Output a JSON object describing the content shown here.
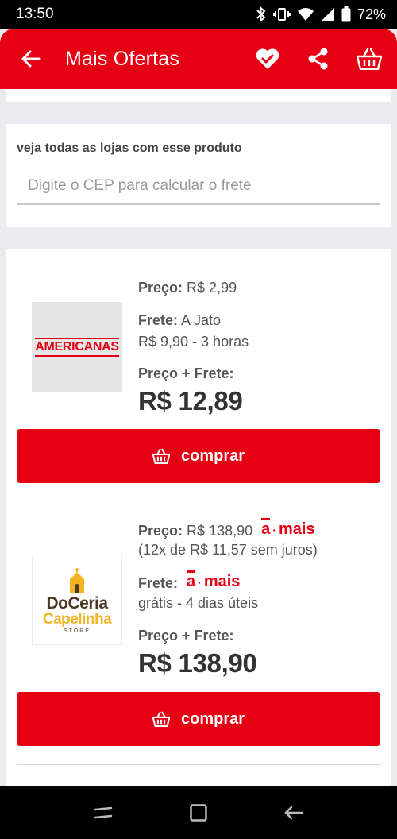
{
  "status_bar": {
    "time": "13:50",
    "battery": "72%"
  },
  "app_bar": {
    "title": "Mais Ofertas",
    "icons": [
      "back-arrow-icon",
      "heart-icon",
      "share-icon",
      "basket-icon"
    ]
  },
  "cep": {
    "label": "veja todas as lojas com esse produto",
    "placeholder": "Digite o CEP para calcular o frete"
  },
  "offers": [
    {
      "store_logo_text": "AMERICANAS",
      "price_label": "Preço:",
      "price_value": "R$ 2,99",
      "shipping_label": "Frete:",
      "shipping_method": "A Jato",
      "shipping_detail": "R$ 9,90 - 3 horas",
      "total_label": "Preço + Frete:",
      "total_value": "R$ 12,89",
      "buy_label": "comprar"
    },
    {
      "store_logo_text": [
        "DoCeria",
        "Capelinha",
        "STORE"
      ],
      "price_label": "Preço:",
      "price_value": "R$ 138,90",
      "price_badge": "mais",
      "installments": "(12x de R$ 11,57 sem juros)",
      "shipping_label": "Frete:",
      "shipping_badge": "mais",
      "shipping_detail": "grátis - 4 dias úteis",
      "total_label": "Preço + Frete:",
      "total_value": "R$ 138,90",
      "buy_label": "comprar"
    }
  ],
  "colors": {
    "brand": "#e60014",
    "background": "#ebebef"
  }
}
